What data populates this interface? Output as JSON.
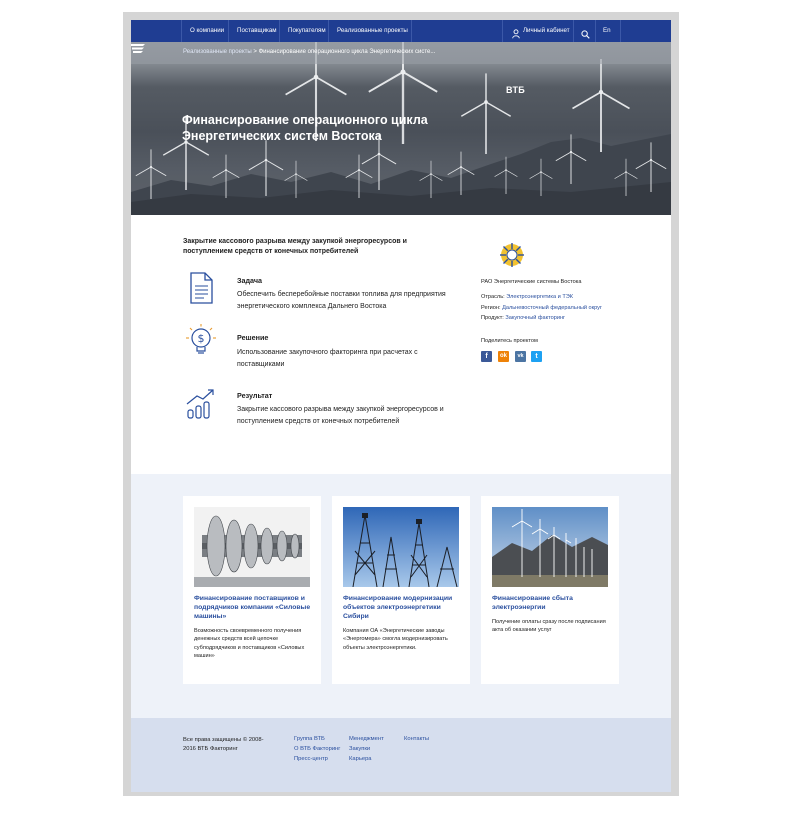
{
  "nav": {
    "items": [
      "О компании",
      "Поставщикам",
      "Покупателям",
      "Реализованные проекты"
    ],
    "cabinet": "Личный кабинет",
    "lang": "En",
    "search_icon": "search-icon",
    "user_icon": "user-icon"
  },
  "hero": {
    "breadcrumb_link": "Реализованные проекты",
    "breadcrumb_separator": ">",
    "breadcrumb_current": "Финансирование операционного цикла Энергетических систе...",
    "title": "Финансирование операционного цикла Энергетических систем Востока",
    "logo_text": "ВТБ"
  },
  "content": {
    "title": "Закрытие кассового разрыва между закупкой энергоресурсов и поступлением средств от конечных потребителей",
    "blocks": [
      {
        "label": "Задача",
        "text": "Обеспечить бесперебойные поставки топлива для предприятия энергетического комплекса Дальнего Востока",
        "icon": "document-icon"
      },
      {
        "label": "Решение",
        "text": "Использование закупочного факторинга при расчетах с поставщиками",
        "icon": "lightbulb-dollar-icon"
      },
      {
        "label": "Результат",
        "text": "Закрытие кассового разрыва между закупкой энергоресурсов и поступлением средств от конечных потребителей",
        "icon": "growth-chart-icon"
      }
    ]
  },
  "sidebar": {
    "company": "РАО Энергетические системы Востока",
    "industry_label": "Отрасль:",
    "industry_value": "Электроэнергетика и ТЭК",
    "region_label": "Регион:",
    "region_value": "Дальневосточный федеральный округ",
    "product_label": "Продукт:",
    "product_value": "Закупочный факторинг",
    "share_label": "Поделитесь проектом",
    "share_icons": [
      {
        "name": "facebook-icon",
        "glyph": "f",
        "color": "#3b5998"
      },
      {
        "name": "odnoklassniki-icon",
        "glyph": "ok",
        "color": "#ee8208"
      },
      {
        "name": "vk-icon",
        "glyph": "vk",
        "color": "#4c75a3"
      },
      {
        "name": "twitter-icon",
        "glyph": "t",
        "color": "#1da1f2"
      }
    ]
  },
  "cards": [
    {
      "title": "Финансирование поставщиков и подрядчиков компании «Силовые машины»",
      "text": "Возможность своевременного получения денежных средств всей цепочке субподрядчиков и поставщиков «Силовых машин»"
    },
    {
      "title": "Финансирование модернизации объектов электроэнергетики Сибири",
      "text": "Компания ОА «Энергетические заводы «Энергомера» смогла модернизировать объекты электроэнергетики."
    },
    {
      "title": "Финансирование сбыта электроэнергии",
      "text": "Получение оплаты сразу после подписания акта об оказании услуг"
    }
  ],
  "footer": {
    "copyright": "Все права защищены © 2008-2016 ВТБ Факторинг",
    "col1": [
      "Группа ВТБ",
      "О ВТБ Факторинг",
      "Пресс-центр"
    ],
    "col2": [
      "Менеджмент",
      "Закупки",
      "Карьера"
    ],
    "col3": [
      "Контакты"
    ]
  },
  "colors": {
    "nav": "#1f3d92",
    "link": "#2a4f9e",
    "cards_bg": "#eef2f9",
    "footer_bg": "#d6deee"
  }
}
